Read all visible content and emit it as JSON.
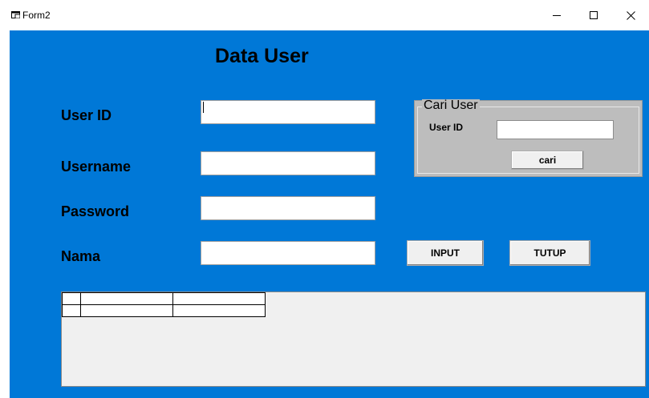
{
  "window": {
    "title": "Form2",
    "controls": [
      "minimize",
      "maximize",
      "close"
    ]
  },
  "colors": {
    "client_background": "#0078d7",
    "groupbox_background": "#bdbdbd",
    "button_face": "#f0f0f0"
  },
  "form": {
    "heading": "Data User",
    "fields": [
      {
        "label": "User ID",
        "value": ""
      },
      {
        "label": "Username",
        "value": ""
      },
      {
        "label": "Password",
        "value": ""
      },
      {
        "label": "Nama",
        "value": ""
      }
    ]
  },
  "search": {
    "group_title": "Cari User",
    "field_label": "User ID",
    "value": "",
    "button_label": "cari"
  },
  "actions": {
    "input_label": "INPUT",
    "close_label": "TUTUP"
  },
  "grid": {
    "columns": [
      "",
      "",
      ""
    ],
    "rows": [
      [
        "",
        "",
        ""
      ]
    ]
  }
}
